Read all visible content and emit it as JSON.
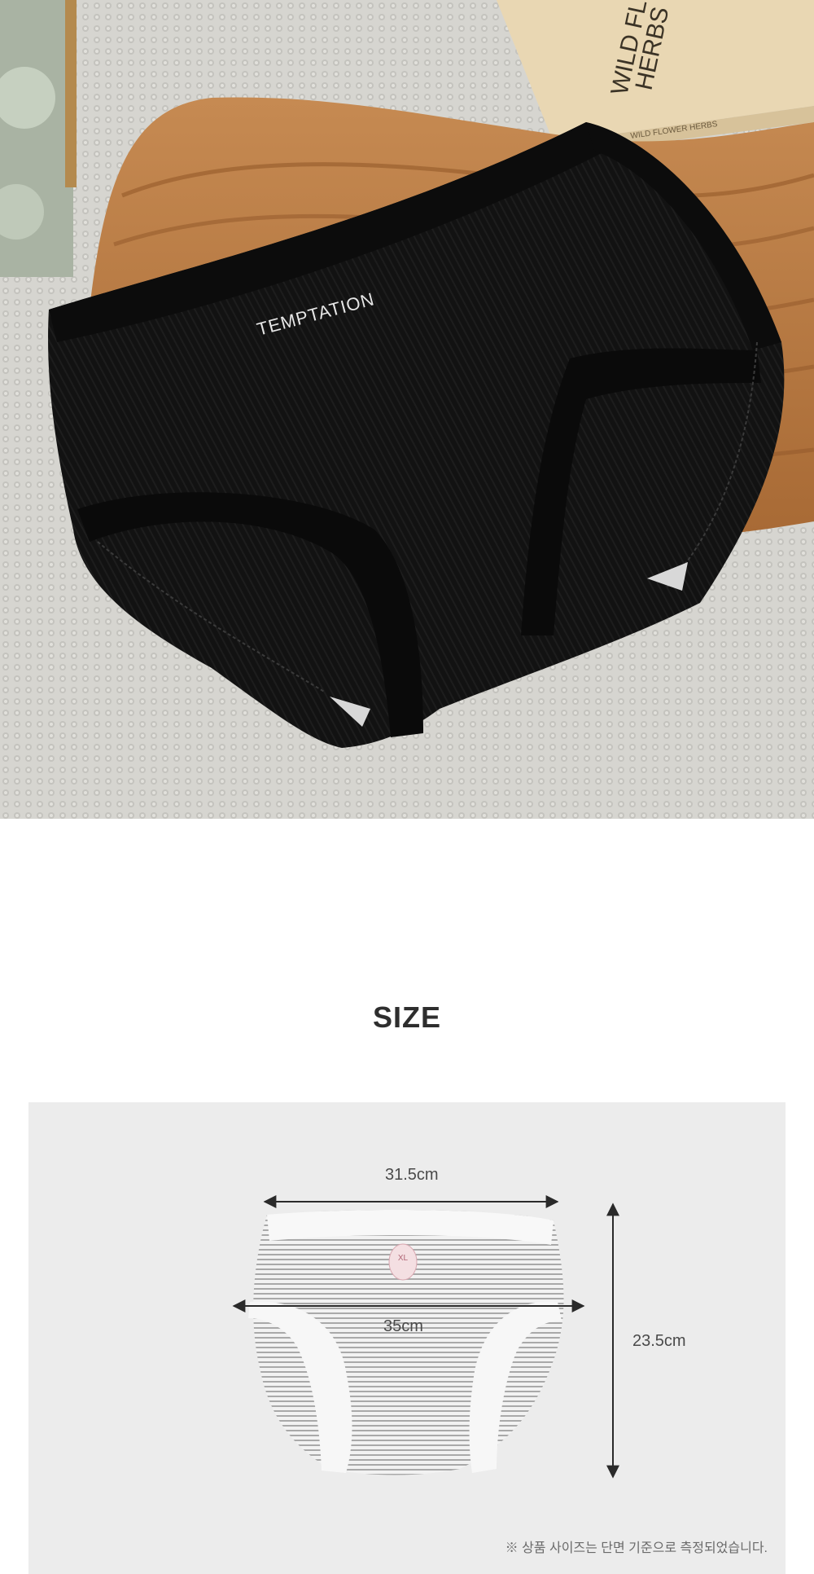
{
  "product_photo": {
    "waistband_text": "TEMPTATION",
    "book_cover_text": [
      "WILD FL",
      "HERBS"
    ],
    "book_spine_text": "WILD FLOWER HERBS"
  },
  "size_section": {
    "title": "SIZE",
    "width_top": "31.5cm",
    "width_bottom": "35cm",
    "height": "23.5cm",
    "tag_size": "XL",
    "note": "※ 상품 사이즈는 단면 기준으로 측정되었습니다."
  },
  "colors": {
    "garment": "#111111",
    "panel_background": "#ececec",
    "title": "#2e2e2e"
  }
}
